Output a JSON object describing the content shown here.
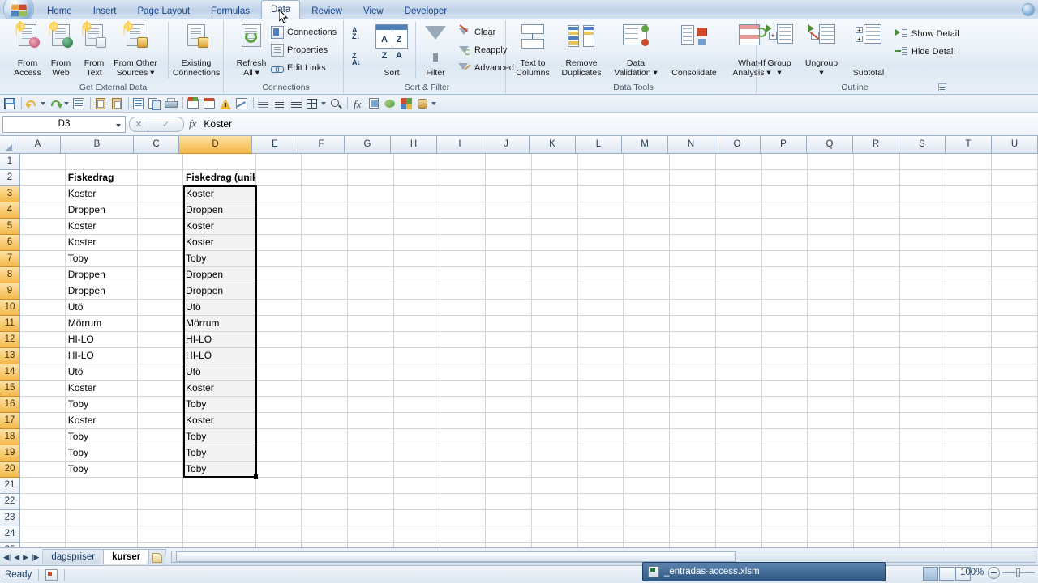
{
  "window": {
    "tab_bar": {
      "office_button": "Office",
      "tabs": [
        {
          "label": "Home",
          "active": false
        },
        {
          "label": "Insert",
          "active": false
        },
        {
          "label": "Page Layout",
          "active": false
        },
        {
          "label": "Formulas",
          "active": false
        },
        {
          "label": "Data",
          "active": true
        },
        {
          "label": "Review",
          "active": false
        },
        {
          "label": "View",
          "active": false
        },
        {
          "label": "Developer",
          "active": false
        }
      ],
      "help_icon": "help-icon"
    }
  },
  "ribbon": {
    "groups": [
      {
        "name": "Get External Data",
        "label": "Get External Data",
        "buttons": [
          {
            "line1": "From",
            "line2": "Access",
            "icon": "from-access-icon"
          },
          {
            "line1": "From",
            "line2": "Web",
            "icon": "from-web-icon"
          },
          {
            "line1": "From",
            "line2": "Text",
            "icon": "from-text-icon"
          },
          {
            "line1": "From Other",
            "line2": "Sources ▾",
            "icon": "from-other-sources-icon"
          },
          {
            "line1": "Existing",
            "line2": "Connections",
            "icon": "existing-connections-icon"
          }
        ]
      },
      {
        "name": "Connections",
        "label": "Connections",
        "big": {
          "line1": "Refresh",
          "line2": "All ▾",
          "icon": "refresh-all-icon"
        },
        "items": [
          {
            "label": "Connections",
            "icon": "connections-icon"
          },
          {
            "label": "Properties",
            "icon": "properties-icon"
          },
          {
            "label": "Edit Links",
            "icon": "edit-links-icon"
          }
        ]
      },
      {
        "name": "Sort & Filter",
        "label": "Sort & Filter",
        "sort_asc": "sort-ascending-icon",
        "sort_desc": "sort-descending-icon",
        "sort": {
          "label": "Sort",
          "icon": "sort-icon"
        },
        "filter": {
          "label": "Filter",
          "icon": "filter-icon"
        },
        "items": [
          {
            "label": "Clear",
            "icon": "clear-filter-icon"
          },
          {
            "label": "Reapply",
            "icon": "reapply-icon"
          },
          {
            "label": "Advanced",
            "icon": "advanced-filter-icon"
          }
        ]
      },
      {
        "name": "Data Tools",
        "label": "Data Tools",
        "buttons": [
          {
            "line1": "Text to",
            "line2": "Columns",
            "icon": "text-to-columns-icon"
          },
          {
            "line1": "Remove",
            "line2": "Duplicates",
            "icon": "remove-duplicates-icon"
          },
          {
            "line1": "Data",
            "line2": "Validation ▾",
            "icon": "data-validation-icon"
          },
          {
            "line1": "Consolidate",
            "line2": "",
            "icon": "consolidate-icon"
          },
          {
            "line1": "What-If",
            "line2": "Analysis ▾",
            "icon": "what-if-analysis-icon"
          }
        ]
      },
      {
        "name": "Outline",
        "label": "Outline",
        "buttons": [
          {
            "line1": "Group",
            "line2": "▾",
            "icon": "group-icon"
          },
          {
            "line1": "Ungroup",
            "line2": "▾",
            "icon": "ungroup-icon"
          },
          {
            "line1": "Subtotal",
            "line2": "",
            "icon": "subtotal-icon"
          }
        ],
        "items": [
          {
            "label": "Show Detail",
            "icon": "show-detail-icon"
          },
          {
            "label": "Hide Detail",
            "icon": "hide-detail-icon"
          }
        ],
        "dialog_launcher": "outline-dialog-launcher"
      }
    ]
  },
  "quick_access_toolbar": {
    "icons": [
      "save-icon",
      "undo-icon",
      "redo-icon",
      "print-preview-icon",
      "paste-special-icon",
      "paste-values-icon",
      "open-icon",
      "copy-icon",
      "print-icon",
      "spelling-icon",
      "research-icon",
      "error-check-icon",
      "chart-icon",
      "align-left-icon",
      "align-center-icon",
      "align-right-icon",
      "borders-icon",
      "zoom-icon",
      "function-icon",
      "format-painter-icon",
      "fill-color-icon",
      "conditional-format-icon",
      "freeze-panes-icon"
    ],
    "overflow": "customize-quick-access-toolbar"
  },
  "formula_bar": {
    "name_box": "D3",
    "cancel_icon": "cancel-icon",
    "enter_icon": "enter-icon",
    "fx_label": "fx",
    "formula_value": "Koster"
  },
  "spreadsheet": {
    "columns": [
      {
        "label": "A",
        "width": 56,
        "selected": false
      },
      {
        "label": "B",
        "width": 90,
        "selected": false
      },
      {
        "label": "C",
        "width": 56,
        "selected": false
      },
      {
        "label": "D",
        "width": 90,
        "selected": true
      },
      {
        "label": "E",
        "width": 57,
        "selected": false
      },
      {
        "label": "F",
        "width": 57,
        "selected": false
      },
      {
        "label": "G",
        "width": 57,
        "selected": false
      },
      {
        "label": "H",
        "width": 57,
        "selected": false
      },
      {
        "label": "I",
        "width": 57,
        "selected": false
      },
      {
        "label": "J",
        "width": 57,
        "selected": false
      },
      {
        "label": "K",
        "width": 57,
        "selected": false
      },
      {
        "label": "L",
        "width": 57,
        "selected": false
      },
      {
        "label": "M",
        "width": 57,
        "selected": false
      },
      {
        "label": "N",
        "width": 57,
        "selected": false
      },
      {
        "label": "O",
        "width": 57,
        "selected": false
      },
      {
        "label": "P",
        "width": 57,
        "selected": false
      },
      {
        "label": "Q",
        "width": 57,
        "selected": false
      },
      {
        "label": "R",
        "width": 57,
        "selected": false
      },
      {
        "label": "S",
        "width": 57,
        "selected": false
      },
      {
        "label": "T",
        "width": 57,
        "selected": false
      },
      {
        "label": "U",
        "width": 57,
        "selected": false
      }
    ],
    "row_numbers": [
      "1",
      "2",
      "3",
      "4",
      "5",
      "6",
      "7",
      "8",
      "9",
      "10",
      "11",
      "12",
      "13",
      "14",
      "15",
      "16",
      "17",
      "18",
      "19",
      "20",
      "21",
      "22",
      "23",
      "24",
      "25"
    ],
    "selected_rows": [
      "3",
      "4",
      "5",
      "6",
      "7",
      "8",
      "9",
      "10",
      "11",
      "12",
      "13",
      "14",
      "15",
      "16",
      "17",
      "18",
      "19",
      "20"
    ],
    "headers": {
      "b2": "Fiskedrag",
      "d2": "Fiskedrag (unika)"
    },
    "rows": [
      {
        "row": "1",
        "b": "",
        "d": ""
      },
      {
        "row": "2",
        "b": "Fiskedrag",
        "d": "Fiskedrag (unika)"
      },
      {
        "row": "3",
        "b": "Koster",
        "d": "Koster"
      },
      {
        "row": "4",
        "b": "Droppen",
        "d": "Droppen"
      },
      {
        "row": "5",
        "b": "Koster",
        "d": "Koster"
      },
      {
        "row": "6",
        "b": "Koster",
        "d": "Koster"
      },
      {
        "row": "7",
        "b": "Toby",
        "d": "Toby"
      },
      {
        "row": "8",
        "b": "Droppen",
        "d": "Droppen"
      },
      {
        "row": "9",
        "b": "Droppen",
        "d": "Droppen"
      },
      {
        "row": "10",
        "b": "Utö",
        "d": "Utö"
      },
      {
        "row": "11",
        "b": "Mörrum",
        "d": "Mörrum"
      },
      {
        "row": "12",
        "b": "HI-LO",
        "d": "HI-LO"
      },
      {
        "row": "13",
        "b": "HI-LO",
        "d": "HI-LO"
      },
      {
        "row": "14",
        "b": "Utö",
        "d": "Utö"
      },
      {
        "row": "15",
        "b": "Koster",
        "d": "Koster"
      },
      {
        "row": "16",
        "b": "Toby",
        "d": "Toby"
      },
      {
        "row": "17",
        "b": "Koster",
        "d": "Koster"
      },
      {
        "row": "18",
        "b": "Toby",
        "d": "Toby"
      },
      {
        "row": "19",
        "b": "Toby",
        "d": "Toby"
      },
      {
        "row": "20",
        "b": "Toby",
        "d": "Toby"
      },
      {
        "row": "21",
        "b": "",
        "d": ""
      },
      {
        "row": "22",
        "b": "",
        "d": ""
      },
      {
        "row": "23",
        "b": "",
        "d": ""
      },
      {
        "row": "24",
        "b": "",
        "d": ""
      },
      {
        "row": "25",
        "b": "",
        "d": ""
      }
    ],
    "selection_range": "D3:D20"
  },
  "sheet_tabs": {
    "nav": [
      "first-sheet",
      "previous-sheet",
      "next-sheet",
      "last-sheet"
    ],
    "tabs": [
      {
        "label": "dagspriser",
        "active": false
      },
      {
        "label": "kurser",
        "active": true
      }
    ],
    "insert_sheet": "insert-worksheet-icon"
  },
  "status_bar": {
    "status": "Ready",
    "macro_icon": "record-macro-icon",
    "view_buttons": [
      "normal-view",
      "page-layout-view",
      "page-break-preview"
    ],
    "zoom": "100%"
  },
  "taskbar": {
    "window_title": "_entradas-access.xlsm",
    "window_icon": "excel-file-icon"
  }
}
